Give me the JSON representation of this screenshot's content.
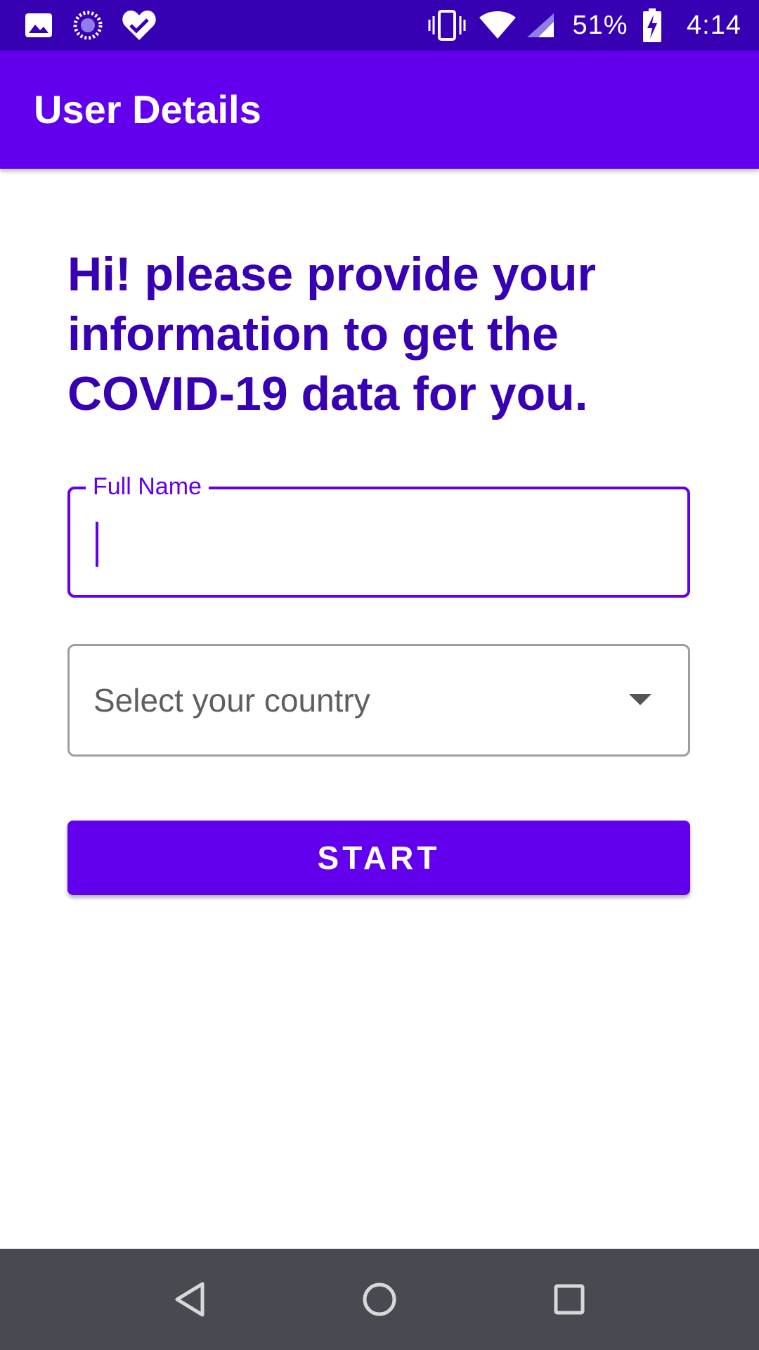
{
  "status_bar": {
    "battery_percent": "51%",
    "time": "4:14",
    "left_icons": [
      "image-icon",
      "loading-icon",
      "heart-check-icon"
    ],
    "right_icons": [
      "vibrate-icon",
      "wifi-icon",
      "signal-icon",
      "battery-charging-icon"
    ]
  },
  "app_bar": {
    "title": "User Details",
    "color": "#6200ee"
  },
  "main": {
    "headline": "Hi! please provide your information to get the COVID-19 data for you.",
    "full_name": {
      "label": "Full Name",
      "value": ""
    },
    "country": {
      "placeholder": "Select your country"
    },
    "start_button": {
      "label": "START"
    }
  },
  "nav_bar": {
    "icons": [
      "back-icon",
      "home-icon",
      "recents-icon"
    ]
  },
  "colors": {
    "primary": "#6200ee",
    "primary_dark": "#3700b3",
    "nav_bar": "#474b51"
  }
}
